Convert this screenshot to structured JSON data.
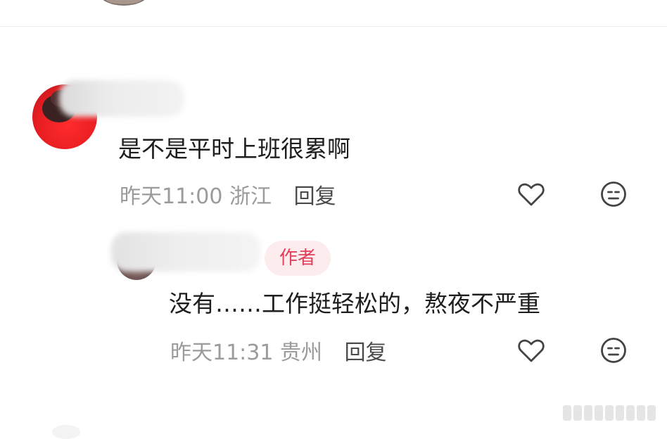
{
  "comment": {
    "text": "是不是平时上班很累啊",
    "time": "昨天11:00",
    "location": "浙江",
    "reply_label": "回复"
  },
  "reply": {
    "author_badge": "作者",
    "text": "没有……工作挺轻松的，熬夜不严重",
    "time": "昨天11:31",
    "location": "贵州",
    "reply_label": "回复"
  },
  "icons": {
    "like": "heart-icon",
    "dislike": "neutral-face-icon"
  },
  "colors": {
    "badge_text": "#e0405a",
    "badge_bg": "#fdecee",
    "meta_gray": "#9b9b9b"
  }
}
